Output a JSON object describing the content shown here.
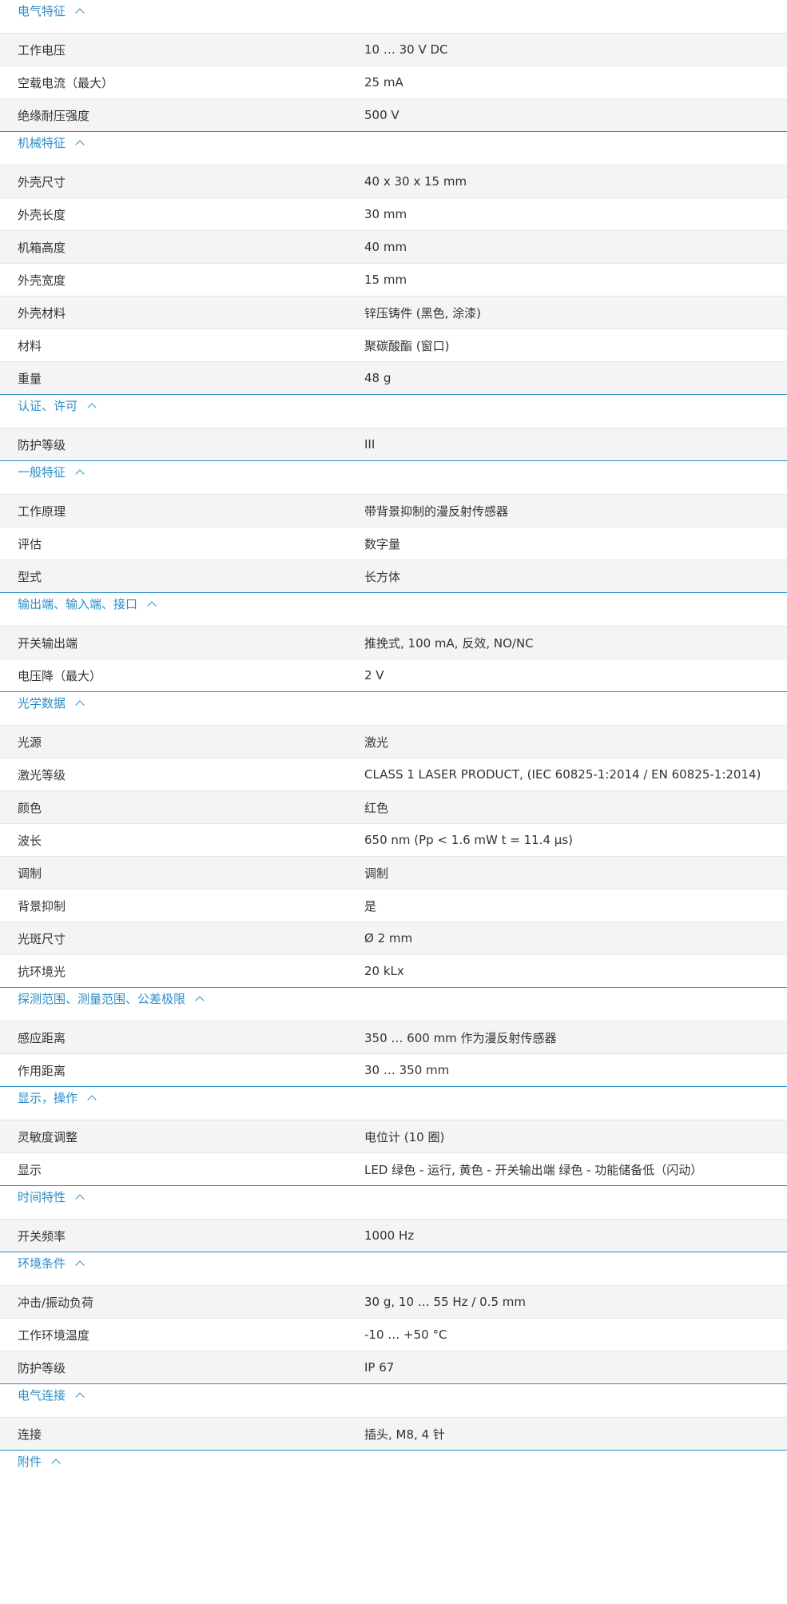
{
  "sections": [
    {
      "title": "电气特征",
      "rows": [
        {
          "label": "工作电压",
          "value": "10 … 30 V DC"
        },
        {
          "label": "空载电流（最大）",
          "value": "25 mA"
        },
        {
          "label": "绝缘耐压强度",
          "value": "500 V"
        }
      ]
    },
    {
      "title": "机械特征",
      "rows": [
        {
          "label": "外壳尺寸",
          "value": "40 x 30 x 15 mm"
        },
        {
          "label": "外壳长度",
          "value": "30 mm"
        },
        {
          "label": "机箱高度",
          "value": "40 mm"
        },
        {
          "label": "外壳宽度",
          "value": "15 mm"
        },
        {
          "label": "外壳材料",
          "value": "锌压铸件 (黑色, 涂漆)"
        },
        {
          "label": "材料",
          "value": "聚碳酸酯 (窗口)"
        },
        {
          "label": "重量",
          "value": "48 g"
        }
      ]
    },
    {
      "title": "认证、许可",
      "rows": [
        {
          "label": "防护等级",
          "value": "III"
        }
      ]
    },
    {
      "title": "一般特征",
      "rows": [
        {
          "label": "工作原理",
          "value": "带背景抑制的漫反射传感器"
        },
        {
          "label": "评估",
          "value": "数字量"
        },
        {
          "label": "型式",
          "value": "长方体"
        }
      ]
    },
    {
      "title": "输出端、输入端、接口",
      "rows": [
        {
          "label": "开关输出端",
          "value": "推挽式, 100 mA, 反效, NO/NC"
        },
        {
          "label": "电压降（最大）",
          "value": "2 V"
        }
      ]
    },
    {
      "title": "光学数据",
      "rows": [
        {
          "label": "光源",
          "value": "激光"
        },
        {
          "label": "激光等级",
          "value": "CLASS 1 LASER PRODUCT, (IEC 60825-1:2014 / EN 60825-1:2014)"
        },
        {
          "label": "颜色",
          "value": "红色"
        },
        {
          "label": "波长",
          "value": "650 nm (Pp < 1.6 mW t = 11.4 µs)"
        },
        {
          "label": "调制",
          "value": "调制"
        },
        {
          "label": "背景抑制",
          "value": "是"
        },
        {
          "label": "光斑尺寸",
          "value": "Ø 2 mm"
        },
        {
          "label": "抗环境光",
          "value": "20 kLx"
        }
      ]
    },
    {
      "title": "探测范围、测量范围、公差极限",
      "rows": [
        {
          "label": "感应距离",
          "value": "350 … 600 mm 作为漫反射传感器"
        },
        {
          "label": "作用距离",
          "value": "30 … 350 mm"
        }
      ]
    },
    {
      "title": "显示，操作",
      "rows": [
        {
          "label": "灵敏度调整",
          "value": "电位计 (10 圈)"
        },
        {
          "label": "显示",
          "value": "LED 绿色 - 运行, 黄色 - 开关输出端 绿色 - 功能储备低（闪动）"
        }
      ]
    },
    {
      "title": "时间特性",
      "rows": [
        {
          "label": "开关频率",
          "value": "1000 Hz"
        }
      ]
    },
    {
      "title": "环境条件",
      "rows": [
        {
          "label": "冲击/振动负荷",
          "value": "30 g, 10 … 55 Hz / 0.5 mm"
        },
        {
          "label": "工作环境温度",
          "value": "-10 … +50 °C"
        },
        {
          "label": "防护等级",
          "value": "IP 67"
        }
      ]
    },
    {
      "title": "电气连接",
      "rows": [
        {
          "label": "连接",
          "value": "插头, M8, 4 针"
        }
      ]
    },
    {
      "title": "附件",
      "rows": []
    }
  ],
  "colors": {
    "accent": "#2b8ec6",
    "row_shaded": "#f4f4f4",
    "text": "#333333"
  },
  "icons": {
    "section_toggle": "chevron-up-icon"
  }
}
